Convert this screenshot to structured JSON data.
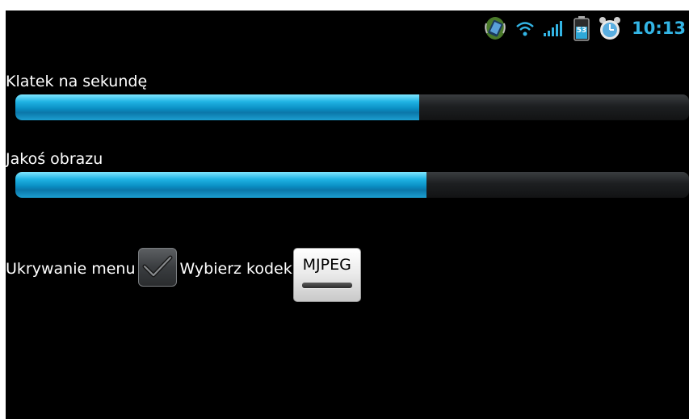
{
  "status_bar": {
    "time": "10:13",
    "battery_level": "53",
    "icons": [
      "sync-icon",
      "wifi-icon",
      "signal-icon",
      "battery-icon",
      "alarm-icon"
    ],
    "clock_color": "#33b5e5"
  },
  "settings": {
    "fps": {
      "label": "Klatek na sekundę",
      "value_fraction": 0.6
    },
    "quality": {
      "label": "Jakoś obrazu",
      "value_fraction": 0.61
    },
    "hide_menu": {
      "label": "Ukrywanie menu",
      "checked": true
    },
    "codec": {
      "label": "Wybierz kodek",
      "selected": "MJPEG"
    }
  },
  "colors": {
    "background": "#000000",
    "accent": "#1fb3e3",
    "text": "#ffffff"
  }
}
